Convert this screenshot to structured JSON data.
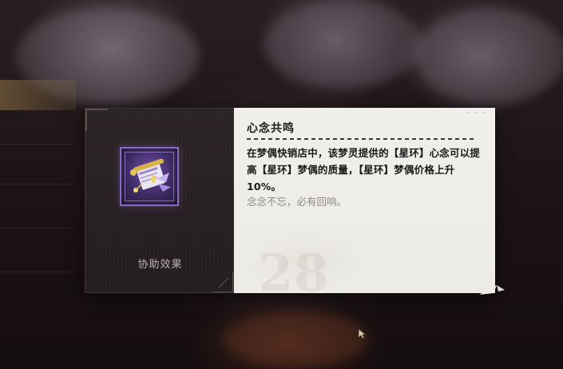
{
  "tooltip": {
    "category_label": "协助效果",
    "title": "心念共鸣",
    "description": "在梦偶快销店中，该梦灵提供的【星环】心念可以提高【星环】梦偶的质量，【星环】梦偶价格上升10%。",
    "flavor_note": "念念不忘，必有回响。",
    "icon": "purple-scroll-icon",
    "icon_color": "#8a6bc4"
  }
}
